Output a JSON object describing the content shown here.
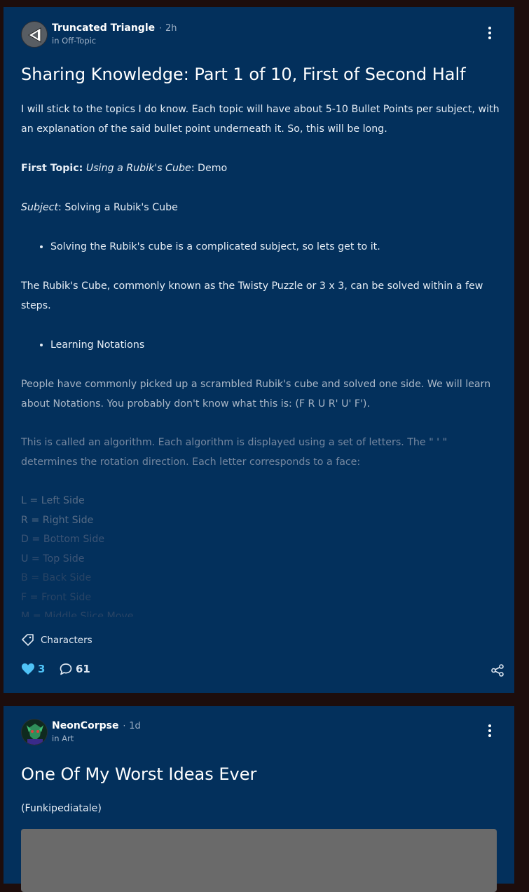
{
  "posts": [
    {
      "author": "Truncated Triangle",
      "time": "2h",
      "community": "in Off-Topic",
      "title": "Sharing Knowledge: Part 1 of 10, First of Second Half",
      "body": {
        "intro": "I will stick to the topics I do know. Each topic will have about 5-10 Bullet Points per subject, with an explanation of the said bullet point underneath it. So, this will be long.",
        "first_topic_label": "First Topic:",
        "first_topic_italic": "Using a Rubik's Cube",
        "first_topic_rest": ": Demo",
        "subject_label": "Subject",
        "subject_rest": ": Solving a Rubik's Cube",
        "bullet_1": "Solving the Rubik's cube is a complicated subject, so lets get to it.",
        "para_2": "The Rubik's Cube, commonly known as the Twisty Puzzle or 3 x 3, can be solved within a few steps.",
        "bullet_2": "Learning Notations",
        "para_3": "People have commonly picked up a scrambled Rubik's cube and solved one side. We will learn about Notations. You probably don't know what this is: (F R U R' U' F').",
        "para_4": "This is called an algorithm. Each algorithm is displayed using a set of letters. The \" ' \" determines the rotation direction. Each letter corresponds to a face:",
        "faces": [
          "L = Left Side",
          "R = Right Side",
          "D = Bottom Side",
          "U = Top Side",
          "B = Back Side",
          "F = Front Side",
          "M = Middle Slice Move"
        ]
      },
      "tag": "Characters",
      "likes": "3",
      "comments": "61"
    },
    {
      "author": "NeonCorpse",
      "time": "1d",
      "community": "in Art",
      "title": "One Of My Worst Ideas Ever",
      "subtext": "(Funkipediatale)"
    }
  ],
  "colors": {
    "page_background": "#1d0d0c",
    "card_background": "#03305c",
    "like_accent": "#4fc3f7",
    "image_placeholder": "#6a6a6a"
  },
  "icons": [
    "triangle-avatar-icon",
    "more-vertical-icon",
    "tag-icon",
    "heart-icon",
    "comment-icon",
    "share-icon",
    "character-avatar-icon"
  ]
}
